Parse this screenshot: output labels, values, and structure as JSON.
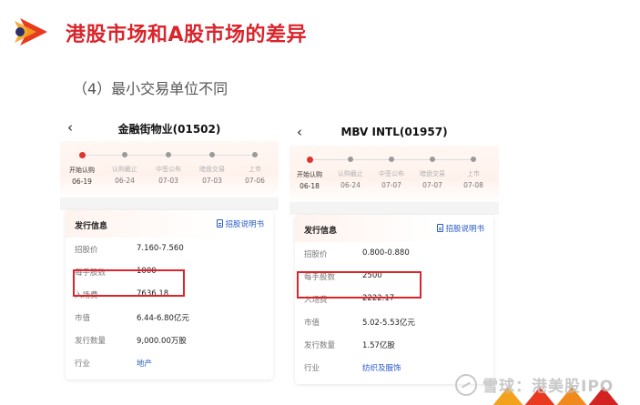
{
  "slide": {
    "title": "港股市场和A股市场的差异",
    "subtitle": "（4）最小交易单位不同"
  },
  "panels": [
    {
      "stock_name": "金融街物业(01502)",
      "timeline": [
        {
          "label": "开始认购",
          "date": "06-19",
          "active": true
        },
        {
          "label": "认购截止",
          "date": "06-24"
        },
        {
          "label": "中签公布",
          "date": "07-03"
        },
        {
          "label": "暗盘交易",
          "date": "07-03"
        },
        {
          "label": "上市",
          "date": "07-06"
        }
      ],
      "info_title": "发行信息",
      "prospectus_label": "招股说明书",
      "rows": [
        {
          "label": "招股价",
          "value": "7.160-7.560"
        },
        {
          "label": "每手股数",
          "value": "1000"
        },
        {
          "label": "入场费",
          "value": "7636.18"
        },
        {
          "label": "市值",
          "value": "6.44-6.80亿元"
        },
        {
          "label": "发行数量",
          "value": "9,000.00万股"
        },
        {
          "label": "行业",
          "value": "地产"
        }
      ]
    },
    {
      "stock_name": "MBV INTL(01957)",
      "timeline": [
        {
          "label": "开始认购",
          "date": "06-18",
          "active": true
        },
        {
          "label": "认购截止",
          "date": "06-24"
        },
        {
          "label": "中签公布",
          "date": "07-07"
        },
        {
          "label": "暗盘交易",
          "date": "07-07"
        },
        {
          "label": "上市",
          "date": "07-08"
        }
      ],
      "info_title": "发行信息",
      "prospectus_label": "招股说明书",
      "rows": [
        {
          "label": "招股价",
          "value": "0.800-0.880"
        },
        {
          "label": "每手股数",
          "value": "2500"
        },
        {
          "label": "入场费",
          "value": "2222.17"
        },
        {
          "label": "市值",
          "value": "5.02-5.53亿元"
        },
        {
          "label": "发行数量",
          "value": "1.57亿股"
        },
        {
          "label": "行业",
          "value": "纺织及服饰"
        }
      ]
    }
  ],
  "watermark": {
    "text": "雪球：港美股IPO"
  },
  "colors": {
    "accent_red": "#d9252c",
    "link_blue": "#2a5cc7",
    "highlight": "#e0232b"
  }
}
